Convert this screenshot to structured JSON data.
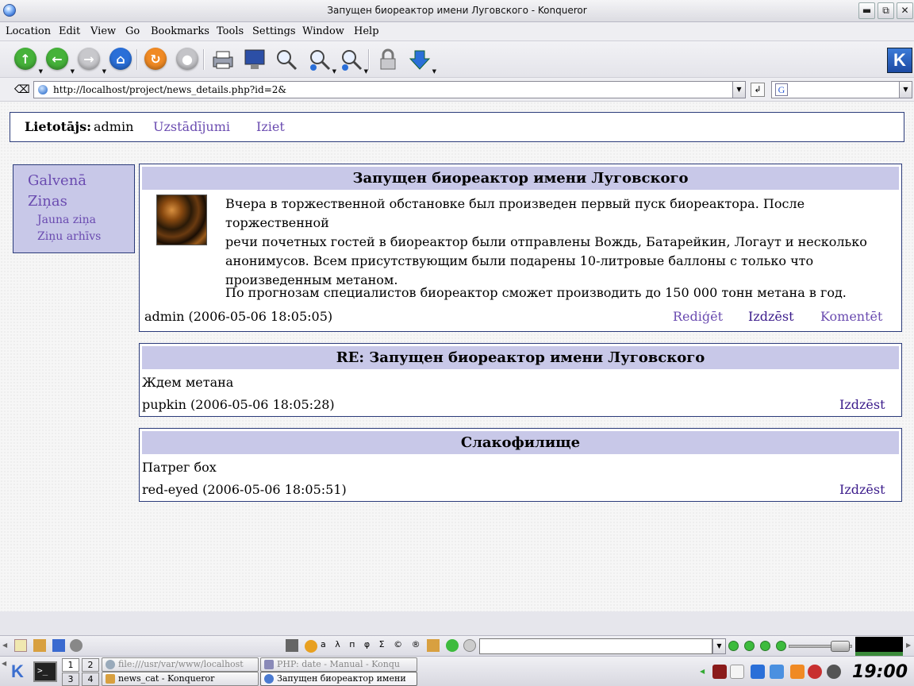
{
  "window": {
    "title": "Запущен биореактор имени Луговского - Konqueror",
    "buttons": [
      "▬",
      "⧉",
      "✕"
    ]
  },
  "menu": [
    "Location",
    "Edit",
    "View",
    "Go",
    "Bookmarks",
    "Tools",
    "Settings",
    "Window",
    "Help"
  ],
  "toolbar": {
    "icons": [
      "up-icon",
      "back-icon",
      "forward-icon",
      "home-icon",
      "reload-icon",
      "stop-icon",
      "print-icon",
      "print-frame-icon",
      "find-icon",
      "zoom-in-icon",
      "zoom-out-icon",
      "security-icon",
      "download-icon"
    ]
  },
  "location": {
    "url": "http://localhost/project/news_details.php?id=2&",
    "search_value": ""
  },
  "page": {
    "user_label": "Lietotājs:",
    "user_name": "admin",
    "settings_link": "Uzstādījumi",
    "logout_link": "Iziet",
    "nav": {
      "main": "Galvenā",
      "news": "Ziņas",
      "new_item": "Jauna ziņa",
      "archive": "Ziņu arhīvs"
    },
    "article": {
      "title": "Запущен биореактор имени Луговского",
      "body_lines": [
        "Вчера в торжественной обстановке был произведен первый пуск биореактора. После торжественной",
        "речи почетных гостей в биореактор были отправлены Вождь, Батарейкин, Логаут и несколько",
        "анонимусов. Всем присутствующим были подарены 10-литровые баллоны с только что",
        "произведенным метаном."
      ],
      "body_p2": "По прогнозам специалистов биореактор сможет производить до 150 000 тонн метана в год.",
      "meta": "admin (2006-05-06 18:05:05)",
      "edit": "Rediģēt",
      "delete": "Izdzēst",
      "comment": "Komentēt"
    },
    "comments": [
      {
        "title": "RE: Запущен биореактор имени Луговского",
        "text": "Ждем метана",
        "meta": "pupkin (2006-05-06 18:05:28)",
        "delete": "Izdzēst"
      },
      {
        "title": "Слакофилище",
        "text": "Патрег бох",
        "meta": "red-eyed (2006-05-06 18:05:51)",
        "delete": "Izdzēst"
      }
    ]
  },
  "panel": {
    "charselect": "a λ п φ Σ © ® §",
    "desktops": [
      "1",
      "2",
      "3",
      "4"
    ],
    "tasks": [
      "file:///usr/var/www/localhost",
      "PHP: date - Manual - Konqu",
      "news_cat - Konqueror",
      "Запущен биореактор имени"
    ],
    "terminal_glyph": ">_",
    "clock": "19:00"
  }
}
